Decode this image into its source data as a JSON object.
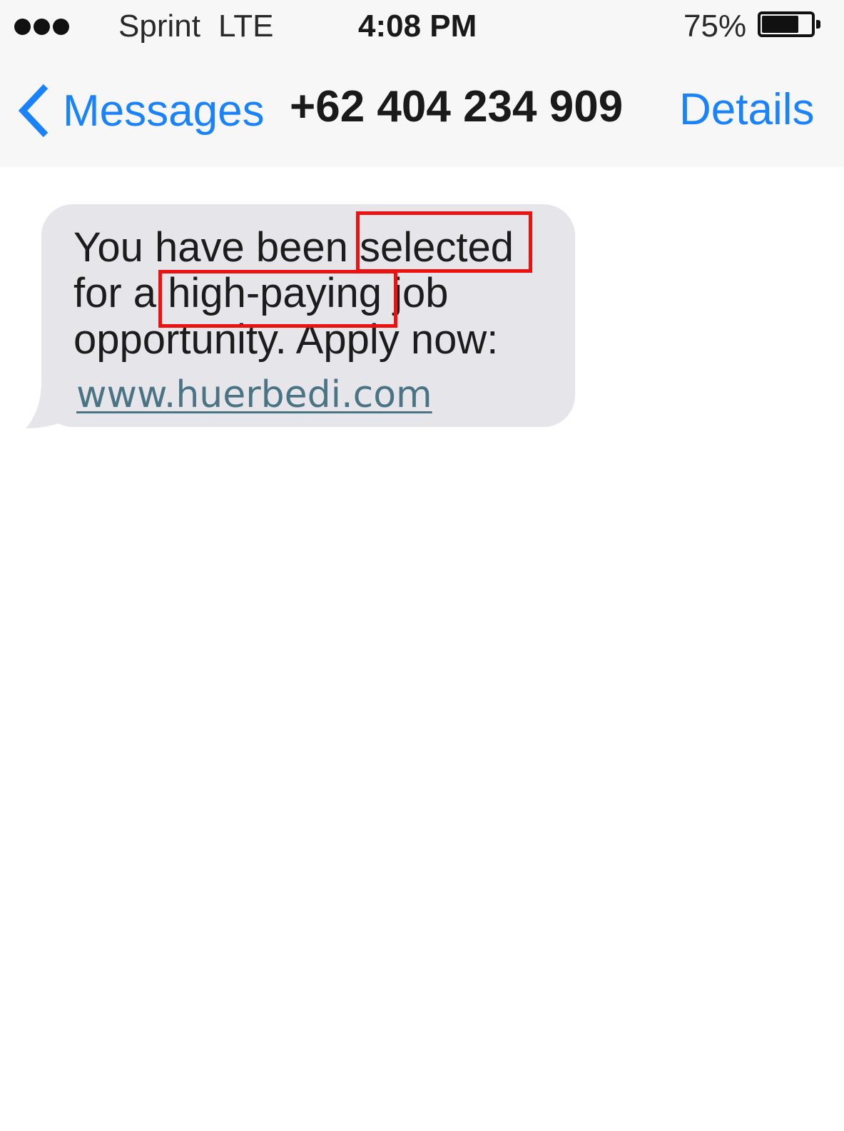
{
  "status_bar": {
    "signal_dots": 3,
    "carrier": "Sprint",
    "network": "LTE",
    "time": "4:08 PM",
    "battery_percent": "75%",
    "battery_level": 0.75
  },
  "nav_bar": {
    "back_icon": "chevron-left-icon",
    "back_label": "Messages",
    "title": "+62 404 234 909",
    "details_label": "Details"
  },
  "message": {
    "lines": [
      "You have been selected",
      "for a high-paying job",
      "opportunity. Apply now:"
    ],
    "link": "www.huerbedi.com"
  },
  "highlights": [
    "selected",
    "high-paying"
  ],
  "colors": {
    "accent": "#1a82fb",
    "bubble": "#e6e5ea",
    "link": "#4a7384",
    "highlight": "#ee1111",
    "bar_background": "#f7f7f7"
  }
}
